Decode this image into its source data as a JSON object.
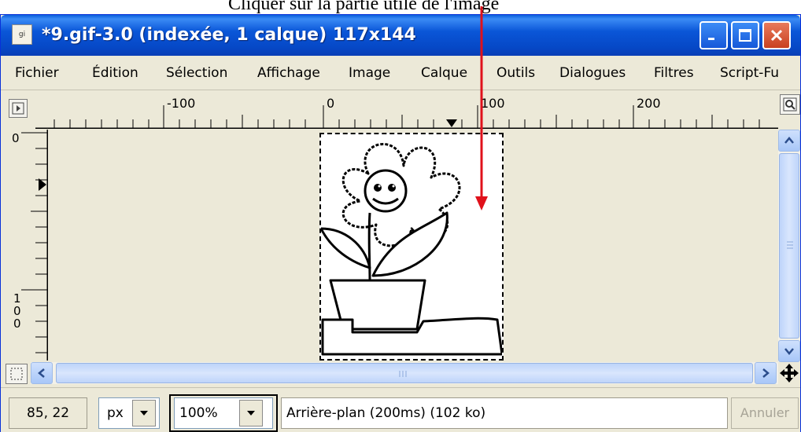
{
  "annotation": {
    "text": "Cliquer sur la partie utile de l'image",
    "arrow_color": "#e0111b"
  },
  "window": {
    "title": "*9.gif-3.0 (indexée, 1 calque) 117x144",
    "app_icon_text": "gi"
  },
  "menu": [
    {
      "label": "Fichier"
    },
    {
      "label": "Édition"
    },
    {
      "label": "Sélection"
    },
    {
      "label": "Affichage"
    },
    {
      "label": "Image"
    },
    {
      "label": "Calque"
    },
    {
      "label": "Outils"
    },
    {
      "label": "Dialogues"
    },
    {
      "label": "Filtres"
    },
    {
      "label": "Script-Fu"
    }
  ],
  "hruler": {
    "labels": [
      "-100",
      "0",
      "100",
      "200"
    ]
  },
  "vruler": {
    "labels": [
      "0",
      "1",
      "0",
      "0"
    ]
  },
  "status": {
    "coords": "85, 22",
    "unit": "px",
    "zoom": "100%",
    "message": "Arrière-plan (200ms) (102 ko)",
    "cancel_label": "Annuler"
  },
  "icons": {
    "navigate": "navigate-icon",
    "zoom": "zoom-icon",
    "quick_mask": "quick-mask-icon"
  }
}
